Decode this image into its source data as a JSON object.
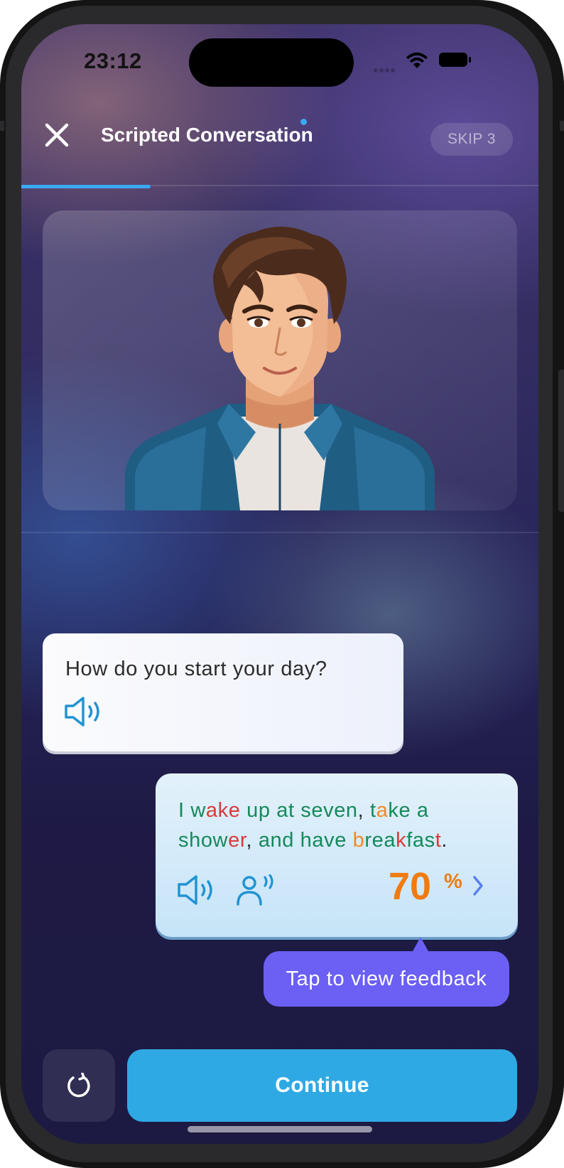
{
  "status_bar": {
    "time": "23:12"
  },
  "header": {
    "title": "Scripted Conversation",
    "skip_label": "SKIP 3",
    "progress_fraction": 0.25
  },
  "colors": {
    "accent": "#2fa9e4",
    "progress": "#3aa8f2",
    "correct": "#15895a",
    "error": "#d83a3a",
    "warning": "#f08a24",
    "score": "#f07b10",
    "tooltip": "#6b5ff4"
  },
  "conversation": {
    "prompt": {
      "text": "How do you start your day?",
      "icon": "speaker-icon"
    },
    "response": {
      "line1": [
        {
          "t": "I ",
          "c": "g"
        },
        {
          "t": "w",
          "c": "g"
        },
        {
          "t": "ake",
          "c": "r"
        },
        {
          "t": " up",
          "c": "g"
        },
        {
          "t": " at seven",
          "c": "g"
        },
        {
          "t": ", ",
          "c": "k"
        },
        {
          "t": "t",
          "c": "g"
        },
        {
          "t": "a",
          "c": "o"
        },
        {
          "t": "ke a",
          "c": "g"
        }
      ],
      "line2": [
        {
          "t": "show",
          "c": "g"
        },
        {
          "t": "er",
          "c": "r"
        },
        {
          "t": ", ",
          "c": "k"
        },
        {
          "t": "and have ",
          "c": "g"
        },
        {
          "t": "b",
          "c": "o"
        },
        {
          "t": "rea",
          "c": "g"
        },
        {
          "t": "k",
          "c": "r"
        },
        {
          "t": "fas",
          "c": "g"
        },
        {
          "t": "t",
          "c": "r"
        },
        {
          "t": ".",
          "c": "k"
        }
      ],
      "score_value": "70",
      "score_unit": "%",
      "icons": [
        "speaker-icon",
        "listen-icon",
        "chevron-right-icon"
      ]
    },
    "tooltip": "Tap to view feedback"
  },
  "footer": {
    "retry_icon": "retry-icon",
    "continue_label": "Continue"
  }
}
